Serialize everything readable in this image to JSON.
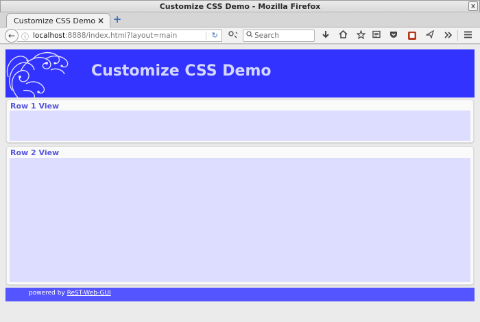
{
  "window": {
    "title": "Customize CSS Demo - Mozilla Firefox",
    "close_glyph": "x"
  },
  "tabs": [
    {
      "label": "Customize CSS Demo",
      "close_glyph": "×"
    }
  ],
  "newtab_glyph": "+",
  "navbar": {
    "back_glyph": "←",
    "info_glyph": "ⓘ",
    "url_host": "localhost",
    "url_rest": ":8888/index.html?layout=main",
    "reload_glyph": "↻",
    "search_placeholder": "Search",
    "icons": [
      "download-icon",
      "home-icon",
      "bookmark-star-icon",
      "reading-list-icon",
      "pocket-icon",
      "extension-icon",
      "send-icon",
      "overflow-icon",
      "menu-icon"
    ]
  },
  "page": {
    "app_title": "Customize CSS Demo",
    "panels": [
      {
        "title": "Row 1 View"
      },
      {
        "title": "Row 2 View"
      }
    ],
    "footer": {
      "powered_prefix": "powered by ",
      "powered_link": "ReST-Web-GUI"
    }
  },
  "colors": {
    "banner": "#3333ff",
    "footer": "#5555ff",
    "panel_body": "#ddddff",
    "panel_title": "#5555dd"
  }
}
